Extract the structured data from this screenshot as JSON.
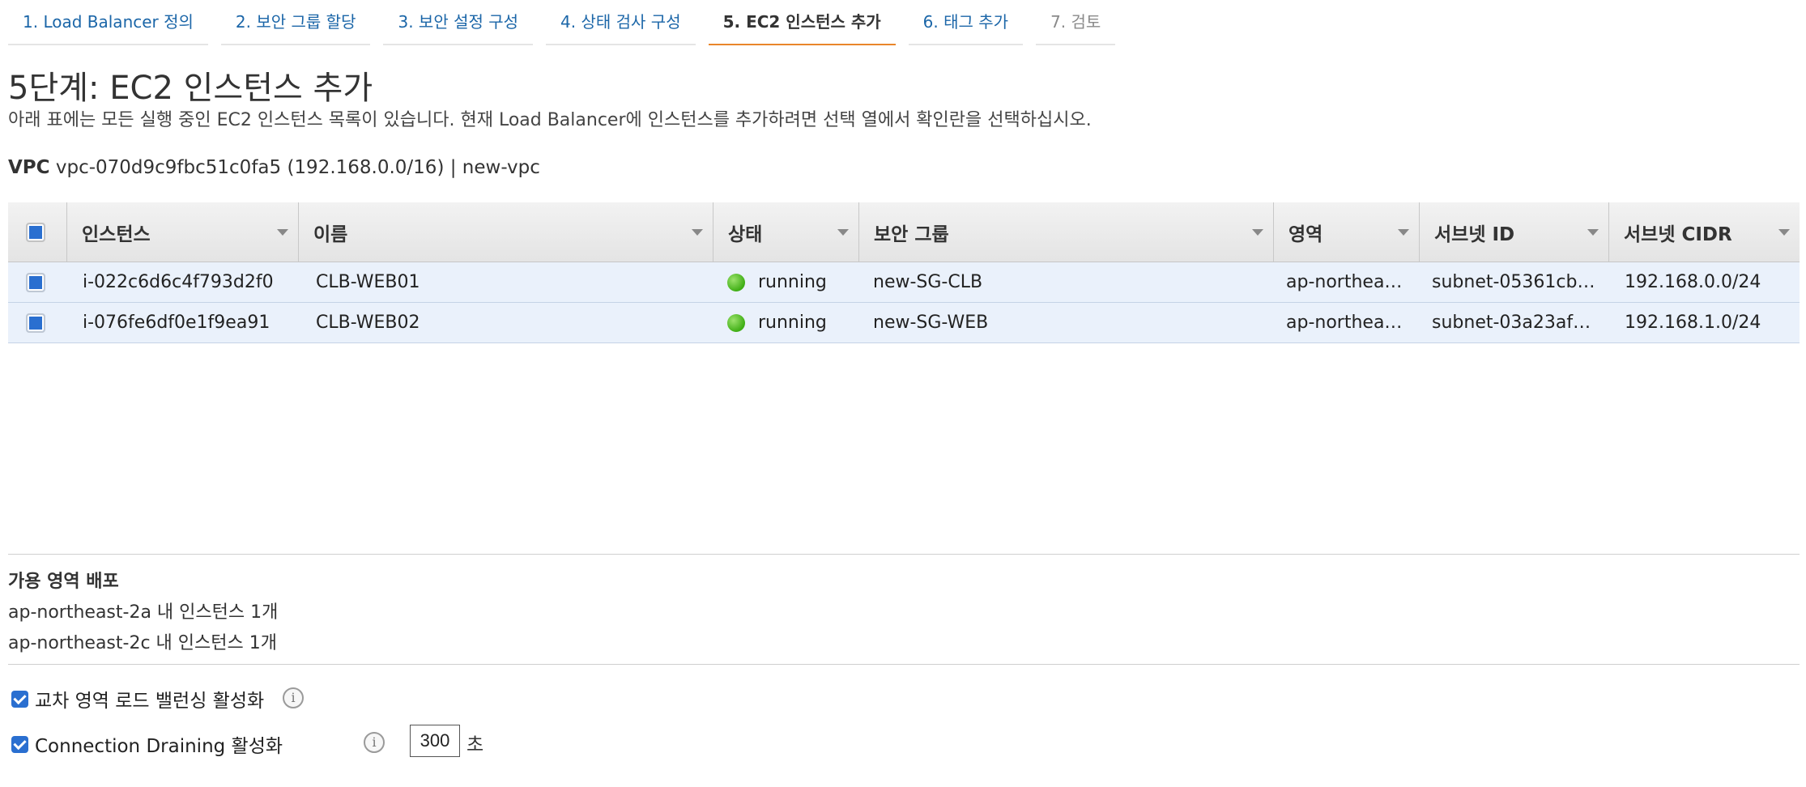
{
  "tabs": [
    {
      "label": "1. Load Balancer 정의",
      "state": "link"
    },
    {
      "label": "2. 보안 그룹 할당",
      "state": "link"
    },
    {
      "label": "3. 보안 설정 구성",
      "state": "link"
    },
    {
      "label": "4. 상태 검사 구성",
      "state": "link"
    },
    {
      "label": "5. EC2 인스턴스 추가",
      "state": "active"
    },
    {
      "label": "6. 태그 추가",
      "state": "link"
    },
    {
      "label": "7. 검토",
      "state": "disabled"
    }
  ],
  "page": {
    "title": "5단계: EC2 인스턴스 추가",
    "description": "아래 표에는 모든 실행 중인 EC2 인스턴스 목록이 있습니다. 현재 Load Balancer에 인스턴스를 추가하려면 선택 열에서 확인란을 선택하십시오.",
    "vpc_label": "VPC",
    "vpc_value": "vpc-070d9c9fbc51c0fa5 (192.168.0.0/16) | new-vpc"
  },
  "table": {
    "columns": [
      "인스턴스",
      "이름",
      "상태",
      "보안 그룹",
      "영역",
      "서브넷 ID",
      "서브넷 CIDR"
    ],
    "rows": [
      {
        "instance": "i-022c6d6c4f793d2f0",
        "name": "CLB-WEB01",
        "status": "running",
        "security_group": "new-SG-CLB",
        "zone": "ap-northea…",
        "subnet_id": "subnet-05361cb…",
        "subnet_cidr": "192.168.0.0/24",
        "selected": true
      },
      {
        "instance": "i-076fe6df0e1f9ea91",
        "name": "CLB-WEB02",
        "status": "running",
        "security_group": "new-SG-WEB",
        "zone": "ap-northea…",
        "subnet_id": "subnet-03a23af…",
        "subnet_cidr": "192.168.1.0/24",
        "selected": true
      }
    ]
  },
  "az_distribution": {
    "title": "가용 영역 배포",
    "lines": [
      "ap-northeast-2a 내 인스턴스 1개",
      "ap-northeast-2c 내 인스턴스 1개"
    ]
  },
  "options": {
    "cross_zone": {
      "label": "교차 영역 로드 밸런싱 활성화",
      "checked": true,
      "icon": "info-icon"
    },
    "connection_draining": {
      "label": "Connection Draining 활성화",
      "checked": true,
      "icon": "info-icon",
      "timeout_value": "300",
      "timeout_unit": "초"
    }
  },
  "colors": {
    "link": "#1b66a8",
    "active_tab_underline": "#e9862a",
    "selected_row": "#eaf1fb",
    "checkbox": "#2a6fd0",
    "status_running": "#3fae15"
  }
}
